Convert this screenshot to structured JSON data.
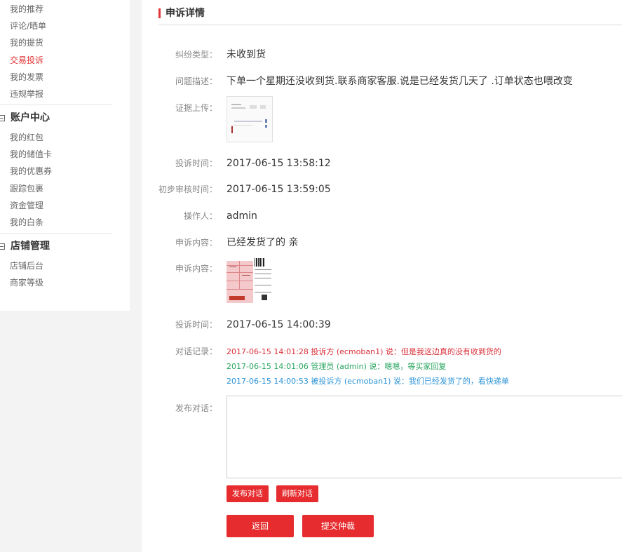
{
  "sidebar": {
    "links_top": [
      "我的推荐",
      "评论/晒单",
      "我的提货",
      "交易投诉",
      "我的发票",
      "违规举报"
    ],
    "account_heading": "账户中心",
    "account_links": [
      "我的红包",
      "我的储值卡",
      "我的优惠券",
      "跟踪包裹",
      "资金管理",
      "我的白条"
    ],
    "shop_heading": "店铺管理",
    "shop_links": [
      "店铺后台",
      "商家等级"
    ]
  },
  "main": {
    "title": "申诉详情",
    "fields": {
      "dispute_type_label": "纠纷类型：",
      "dispute_type_value": "未收到货",
      "description_label": "问题描述：",
      "description_value": "下单一个星期还没收到货.联系商家客服.说是已经发货几天了 .订单状态也喂改变",
      "evidence_label": "证据上传：",
      "complaint_time_label": "投诉时间：",
      "complaint_time_value": "2017-06-15 13:58:12",
      "review_time_label": "初步审核时间：",
      "review_time_value": "2017-06-15 13:59:05",
      "operator_label": "操作人：",
      "operator_value": "admin",
      "appeal_content_label": "申诉内容：",
      "appeal_content_value": "已经发货了的 亲",
      "appeal_image_label": "申诉内容：",
      "appeal_time_label": "投诉时间：",
      "appeal_time_value": "2017-06-15 14:00:39",
      "dialog_label": "对话记录：",
      "post_label": "发布对话："
    },
    "dialog_log": [
      "2017-06-15 14:01:28 投诉方 (ecmoban1) 说：但是我这边真的没有收到货的",
      "2017-06-15 14:01:06 管理员 (admin) 说：嗯嗯，等买家回复",
      "2017-06-15 14:00:53 被投诉方 (ecmoban1) 说：我们已经发货了的，看快递单"
    ],
    "buttons": {
      "post": "发布对话",
      "refresh": "刷新对话",
      "back": "返回",
      "arbitration": "提交仲裁"
    }
  },
  "colors": {
    "accent": "#e62c2e",
    "log_complainant": "#d9303a",
    "log_admin": "#28a55f",
    "log_respondent": "#2a93d5"
  }
}
